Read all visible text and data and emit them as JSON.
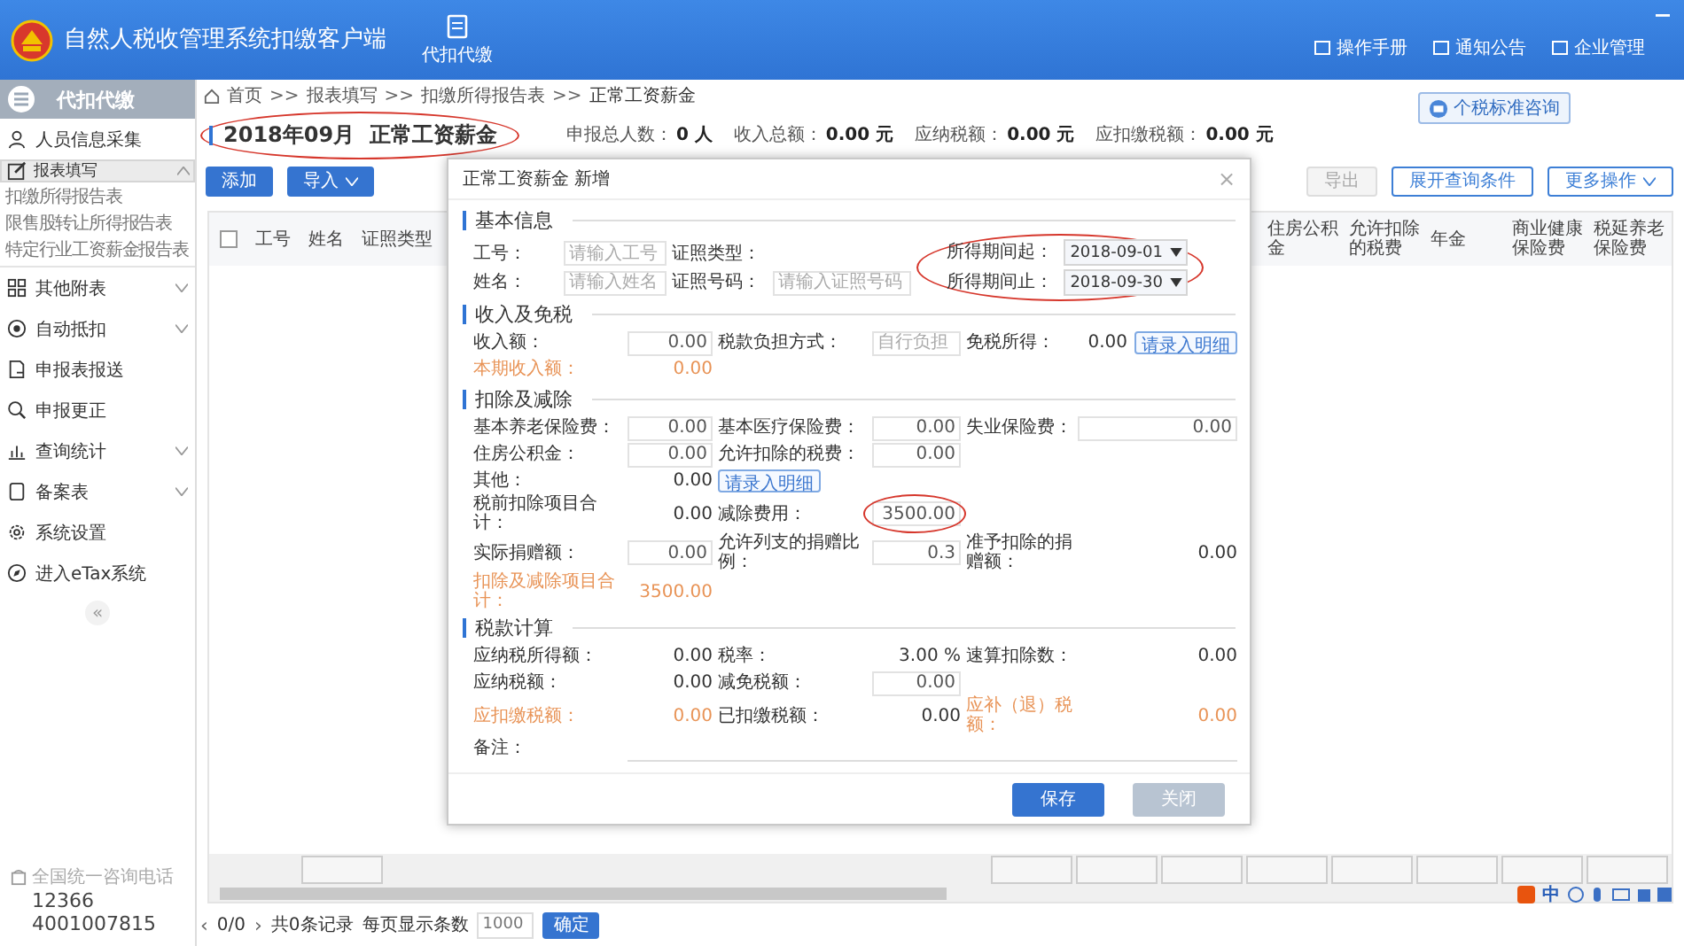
{
  "app": {
    "title": "自然人税收管理系统扣缴客户端",
    "nav_label": "代扣代缴",
    "links": [
      "操作手册",
      "通知公告",
      "企业管理"
    ]
  },
  "sidebar": {
    "header": "代扣代缴",
    "items": [
      {
        "label": "人员信息采集",
        "kind": "link",
        "selected": false
      },
      {
        "label": "报表填写",
        "kind": "group",
        "selected": true,
        "expanded": true,
        "children": [
          {
            "label": "扣缴所得报告表"
          },
          {
            "label": "限售股转让所得报告表"
          },
          {
            "label": "特定行业工资薪金报告表"
          }
        ]
      },
      {
        "label": "其他附表",
        "kind": "group",
        "selected": false,
        "expanded": false
      },
      {
        "label": "自动抵扣",
        "kind": "group",
        "selected": false,
        "expanded": false
      },
      {
        "label": "申报表报送",
        "kind": "link",
        "selected": false
      },
      {
        "label": "申报更正",
        "kind": "link",
        "selected": false
      },
      {
        "label": "查询统计",
        "kind": "group",
        "selected": false,
        "expanded": false
      },
      {
        "label": "备案表",
        "kind": "group",
        "selected": false,
        "expanded": false
      },
      {
        "label": "系统设置",
        "kind": "link",
        "selected": false
      },
      {
        "label": "进入eTax系统",
        "kind": "link",
        "selected": false
      }
    ],
    "collapse": "«",
    "hotline": {
      "caption": "全国统一咨询电话",
      "numbers": [
        "12366",
        "4001007815"
      ]
    }
  },
  "breadcrumb": {
    "separator": ">>",
    "items": [
      "首页",
      "报表填写",
      "扣缴所得报告表",
      "正常工资薪金"
    ]
  },
  "page": {
    "title": "2018年09月  正常工资薪金",
    "circled": true,
    "consult": "个税标准咨询",
    "stats": [
      {
        "label": "申报总人数：",
        "value": "0 人"
      },
      {
        "label": "收入总额：",
        "value": "0.00 元"
      },
      {
        "label": "应纳税额：",
        "value": "0.00 元"
      },
      {
        "label": "应扣缴税额：",
        "value": "0.00 元"
      }
    ],
    "actions": [
      {
        "label": "添加",
        "kind": "plain"
      },
      {
        "label": "导入",
        "kind": "dropdown"
      }
    ],
    "right_actions": [
      {
        "label": "导出",
        "kind": "plain",
        "disabled": true
      },
      {
        "label": "展开查询条件",
        "kind": "plain",
        "disabled": false
      },
      {
        "label": "更多操作",
        "kind": "dropdown",
        "disabled": false
      }
    ]
  },
  "table": {
    "select_all_checked": false,
    "columns_left": [
      "工号",
      "姓名",
      "证照类型"
    ],
    "columns_right": [
      "住房公积金",
      "允许扣除的税费",
      "年金",
      "商业健康保险费",
      "税延养老保险费"
    ]
  },
  "pagination": {
    "prev": "‹",
    "page": "0/0",
    "next": "›",
    "total": "共0条记录",
    "per_page_label": "每页显示条数",
    "per_page_placeholder": "1000",
    "confirm": "确定"
  },
  "ime_toolbar": {
    "label": "中"
  },
  "dialog": {
    "title": "正常工资薪金 新增",
    "close": "×",
    "sections": [
      {
        "title": "基本信息",
        "rows": [
          [
            {
              "label": "工号：",
              "kind": "input",
              "placeholder": "请输入工号"
            },
            {
              "label": "证照类型：",
              "kind": "label"
            }
          ],
          [
            {
              "label": "姓名：",
              "kind": "input",
              "placeholder": "请输入姓名"
            },
            {
              "label": "证照号码：",
              "kind": "input",
              "placeholder": "请输入证照号码"
            }
          ]
        ],
        "side": {
          "circled": true,
          "rows": [
            [
              {
                "label": "所得期间起：",
                "kind": "select",
                "value": "2018-09-01"
              }
            ],
            [
              {
                "label": "所得期间止：",
                "kind": "select",
                "value": "2018-09-30"
              }
            ]
          ]
        }
      },
      {
        "title": "收入及免税",
        "rows": [
          [
            {
              "label": "收入额：",
              "kind": "input",
              "value": "0.00"
            },
            {
              "label": "税款负担方式：",
              "kind": "input",
              "placeholder": "自行负担"
            },
            {
              "label": "免税所得：",
              "kind": "text",
              "value": "0.00",
              "link": "请录入明细"
            }
          ],
          [
            {
              "label": "本期收入额：",
              "kind": "text",
              "value": "0.00",
              "color": "#e89356"
            }
          ]
        ]
      },
      {
        "title": "扣除及减除",
        "rows": [
          [
            {
              "label": "基本养老保险费：",
              "kind": "input",
              "value": "0.00"
            },
            {
              "label": "基本医疗保险费：",
              "kind": "input",
              "value": "0.00"
            },
            {
              "label": "失业保险费：",
              "kind": "input",
              "value": "0.00"
            }
          ],
          [
            {
              "label": "住房公积金：",
              "kind": "input",
              "value": "0.00"
            },
            {
              "label": "允许扣除的税费：",
              "kind": "input",
              "value": "0.00"
            }
          ],
          [
            {
              "label": "其他：",
              "kind": "text",
              "value": "0.00"
            },
            {
              "kind": "link",
              "value": "请录入明细"
            }
          ],
          [
            {
              "label": "税前扣除项目合计：",
              "kind": "text",
              "value": "0.00"
            },
            {
              "label": "减除费用：",
              "kind": "input",
              "value": "3500.00",
              "circled": true
            }
          ],
          [
            {
              "label": "实际捐赠额：",
              "kind": "input",
              "value": "0.00"
            },
            {
              "label": "允许列支的捐赠比例：",
              "kind": "input",
              "value": "0.3"
            },
            {
              "label": "准予扣除的捐赠额：",
              "kind": "text",
              "value": "0.00"
            }
          ],
          [
            {
              "label": "扣除及减除项目合计：",
              "kind": "text",
              "value": "3500.00",
              "color": "#e89356"
            }
          ]
        ]
      },
      {
        "title": "税款计算",
        "rows": [
          [
            {
              "label": "应纳税所得额：",
              "kind": "text",
              "value": "0.00"
            },
            {
              "label": "税率：",
              "kind": "text",
              "value": "3.00 %"
            },
            {
              "label": "速算扣除数：",
              "kind": "text",
              "value": "0.00"
            }
          ],
          [
            {
              "label": "应纳税额：",
              "kind": "text",
              "value": "0.00"
            },
            {
              "label": "减免税额：",
              "kind": "input",
              "value": "0.00"
            }
          ],
          [
            {
              "label": "应扣缴税额：",
              "kind": "text",
              "value": "0.00",
              "color": "#e89356"
            },
            {
              "label": "已扣缴税额：",
              "kind": "text",
              "value": "0.00"
            },
            {
              "label": "应补（退）税额：",
              "kind": "text",
              "value": "0.00",
              "color": "#e89356"
            }
          ],
          [
            {
              "label": "备注：",
              "kind": "line"
            }
          ]
        ]
      }
    ],
    "buttons": [
      {
        "label": "保存",
        "disabled": false
      },
      {
        "label": "关闭",
        "disabled": true
      }
    ]
  }
}
